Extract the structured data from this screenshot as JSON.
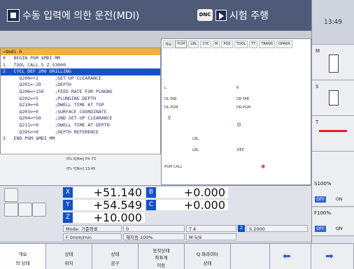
{
  "header": {
    "left_mode": "수동 입력에 의한 운전(MDI)",
    "dnc": "DNC",
    "right_mode": "시험 주행",
    "clock": "13:49"
  },
  "program": {
    "path": "→$mdi.h",
    "lines": [
      "0   BEGIN PGM $MDI MM",
      "1   TOOL CALL 5 Z S3000",
      "2   CYCL DEF 200 DRILLING",
      "      Q200=+2      ;SET-UP CLEARANCE",
      "      Q201=-20     ;DEPTH",
      "      Q206=+150    ;FEED RATE FOR PLNGNG",
      "      Q202=+5      ;PLUNGING DEPTH",
      "      Q210=+0      ;DWELL TIME AT TOP",
      "      Q203=+0      ;SURFACE COORDINATE",
      "      Q204=+50     ;2ND SET-UP CLEARANCE",
      "      Q211=+0      ;DWELL TIME AT DEPTH",
      "      Q395=+0      ;DEPTH REFERENCE",
      "3   END PGM $MDI MM"
    ],
    "info1": "0% X[Nm] P4  -T5",
    "info2": "0% Y[Nm] 13:49"
  },
  "status": {
    "tabs": [
      "개요",
      "PGM",
      "LBL",
      "CYC",
      "M",
      "POS",
      "TOOL",
      "TT",
      "TRANS",
      "QPARA"
    ],
    "L": "L",
    "R": "R",
    "dl_tab": "DL-TAB",
    "dl_pgm": "DL-PGM",
    "dr_tab": "DR-TAB",
    "dr_pgm": "DR-PGM",
    "lbl": "LBL",
    "lbl2": "LBL",
    "rep": "REP",
    "pgm_call": "PGM CALL"
  },
  "coords": [
    {
      "axis": "X",
      "value": "+51.140"
    },
    {
      "axis": "B",
      "value": "+0.000"
    },
    {
      "axis": "Y",
      "value": "+54.549"
    },
    {
      "axis": "C",
      "value": "+0.000"
    },
    {
      "axis": "Z",
      "value": "+10.000"
    }
  ],
  "machine": {
    "mode": "Mode: 기준좌표",
    "feed": "F  0mm/min",
    "override": "재지정 100%",
    "t": "T 4",
    "z_label": "Z",
    "s": "S 2000",
    "m": "M 5/9",
    "zero": "0"
  },
  "right": {
    "keys": [
      "M",
      "S",
      "T"
    ],
    "s_override": "S100%",
    "f_override": "F100%",
    "off": "OFF",
    "on": "ON"
  },
  "softkeys": [
    {
      "l1": "개요",
      "l2": "의 상태"
    },
    {
      "l1": "상태",
      "l2": "위치"
    },
    {
      "l1": "상태",
      "l2": "공구"
    },
    {
      "l1": "동작상태",
      "l2": "좌표계",
      "l3": "이동"
    },
    {
      "l1": "Q 파라미터",
      "l2": "상태"
    },
    {
      "l1": "",
      "l2": ""
    }
  ]
}
